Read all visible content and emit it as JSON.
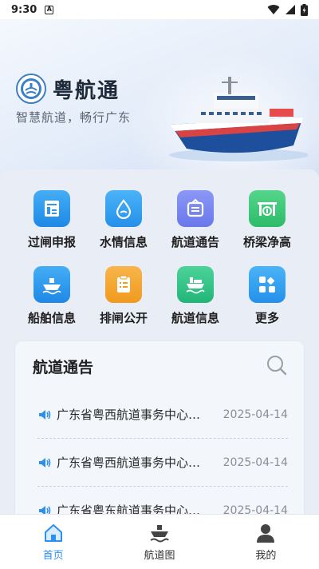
{
  "status_bar": {
    "time": "9:30",
    "notification_letter": "A"
  },
  "header": {
    "app_name": "粤航通",
    "slogan": "智慧航道，畅行广东"
  },
  "quick_actions": [
    {
      "label": "过闸申报",
      "icon": "lock-declare-icon",
      "color": "#2f95ee"
    },
    {
      "label": "水情信息",
      "icon": "water-drop-icon",
      "color": "#2f95ee"
    },
    {
      "label": "航道通告",
      "icon": "notice-board-icon",
      "color": "#7a86f0"
    },
    {
      "label": "桥梁净高",
      "icon": "bridge-icon",
      "color": "#3ec97a"
    },
    {
      "label": "船舶信息",
      "icon": "ship-icon",
      "color": "#2f95ee"
    },
    {
      "label": "排闸公开",
      "icon": "clipboard-icon",
      "color": "#f3a633"
    },
    {
      "label": "航道信息",
      "icon": "channel-ship-icon",
      "color": "#35c585"
    },
    {
      "label": "更多",
      "icon": "more-grid-icon",
      "color": "#2f95ee"
    }
  ],
  "notices": {
    "title": "航道通告",
    "items": [
      {
        "text": "广东省粤西航道事务中心…",
        "date": "2025-04-14"
      },
      {
        "text": "广东省粤西航道事务中心…",
        "date": "2025-04-14"
      },
      {
        "text": "广东省粤东航道事务中心…",
        "date": "2025-04-14"
      }
    ]
  },
  "bottom_nav": [
    {
      "label": "首页",
      "icon": "home-icon",
      "active": true
    },
    {
      "label": "航道图",
      "icon": "ship-map-icon",
      "active": false
    },
    {
      "label": "我的",
      "icon": "user-icon",
      "active": false
    }
  ],
  "colors": {
    "accent": "#2d8ff0",
    "text": "#1f1f1f",
    "date": "#8c8f95"
  }
}
